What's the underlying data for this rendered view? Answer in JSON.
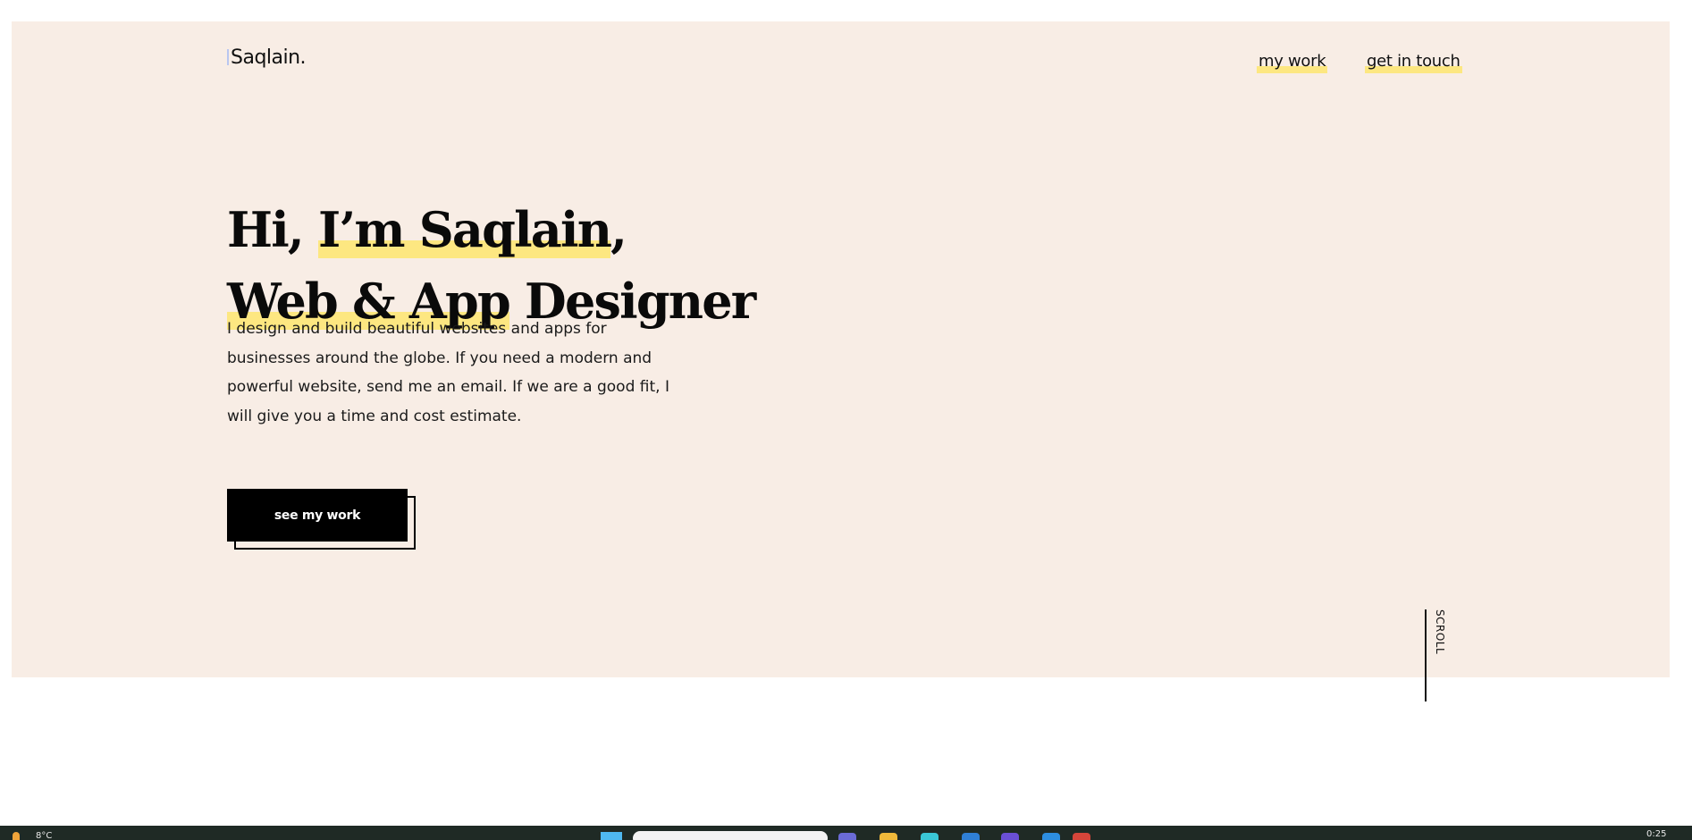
{
  "brand": {
    "logo_text": "Saqlain."
  },
  "nav": {
    "items": [
      {
        "label": "my work"
      },
      {
        "label": "get in touch"
      }
    ]
  },
  "hero": {
    "line1_prefix": "Hi, ",
    "line1_highlight": "I’m Saqlain",
    "line1_suffix": ",",
    "line2_highlight": "Web & App",
    "line2_suffix": " Designer",
    "intro": "I design and build beautiful websites and apps for businesses around the globe. If you need a modern and powerful website, send me an email. If we are a good fit, I will give you a time and cost estimate.",
    "cta_label": "see my work",
    "scroll_label": "SCROLL"
  },
  "taskbar": {
    "weather": "8°C",
    "clock": "0:25",
    "pinned_icons": [
      "chat-icon",
      "folder-icon",
      "app-icon",
      "store-icon",
      "mail-icon",
      "vscode-icon",
      "browser-icon"
    ]
  },
  "colors": {
    "hero_background": "#f8ede5",
    "highlight": "#fde781",
    "text": "#0a0a0a",
    "cta_background": "#000000",
    "taskbar": "#1f2a25"
  }
}
